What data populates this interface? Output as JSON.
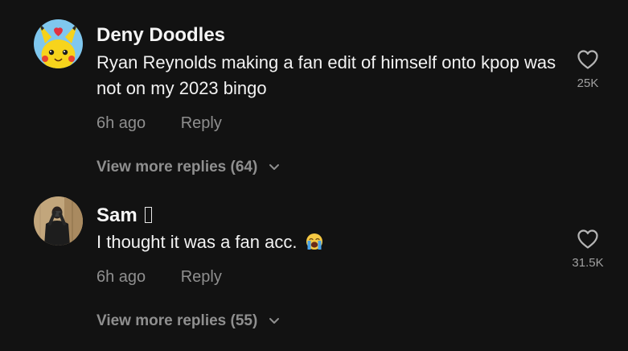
{
  "colors": {
    "background": "#121212",
    "primary_text": "#f2f2f2",
    "secondary_text": "#8f8f8f"
  },
  "comments": [
    {
      "username": "Deny Doodles",
      "avatar_icon": "pikachu-avatar",
      "text": "Ryan Reynolds making a fan edit of himself onto kpop was not on my 2023 bingo",
      "time": "6h ago",
      "reply_label": "Reply",
      "view_more_label": "View more replies (64)",
      "like_count": "25K"
    },
    {
      "username": "Sam",
      "avatar_icon": "person-photo-avatar",
      "text": "I thought it was a fan acc.",
      "emoji": "crying-face-emoji",
      "time": "6h ago",
      "reply_label": "Reply",
      "view_more_label": "View more replies (55)",
      "like_count": "31.5K"
    }
  ]
}
